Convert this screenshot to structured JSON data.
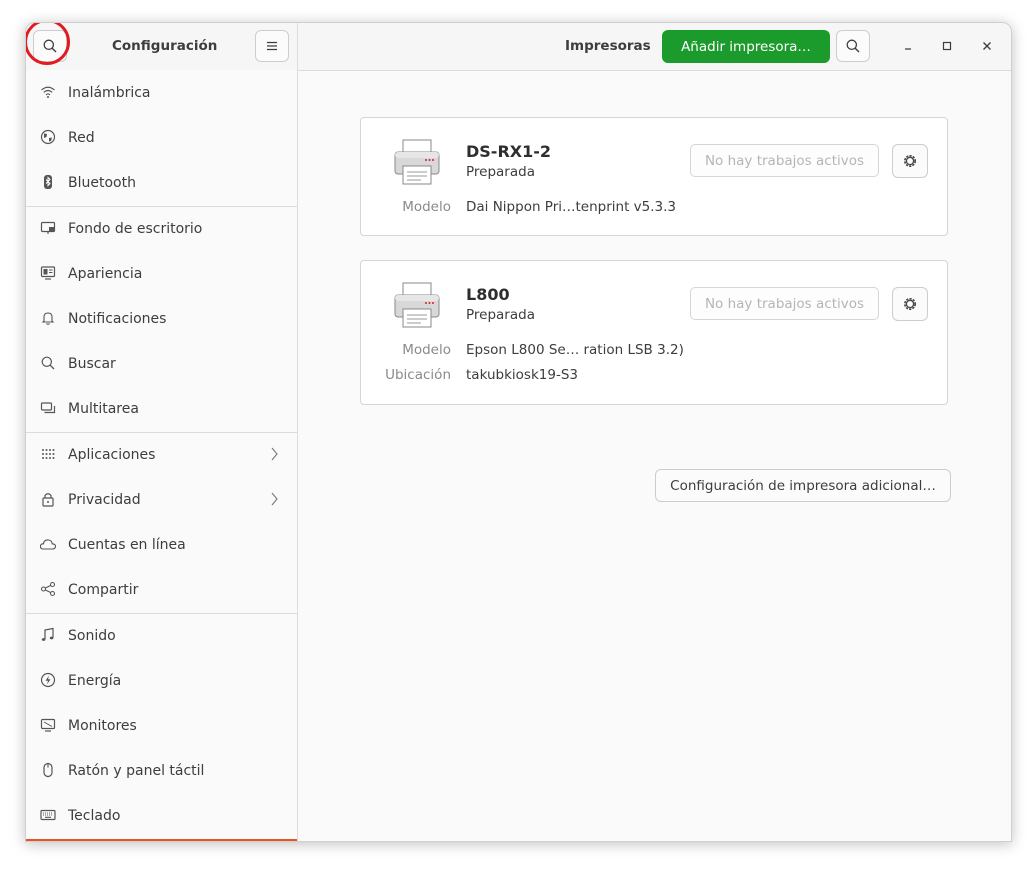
{
  "header": {
    "sidebar_title": "Configuración",
    "page_title": "Impresoras",
    "add_printer_label": "Añadir impresora…",
    "minimize": "–",
    "maximize": "□",
    "close": "×"
  },
  "sidebar": {
    "items": [
      {
        "label": "Inalámbrica",
        "icon": "wifi-icon"
      },
      {
        "label": "Red",
        "icon": "globe-icon"
      },
      {
        "label": "Bluetooth",
        "icon": "bluetooth-icon"
      },
      {
        "label": "Fondo de escritorio",
        "icon": "desktop-background-icon"
      },
      {
        "label": "Apariencia",
        "icon": "appearance-icon"
      },
      {
        "label": "Notificaciones",
        "icon": "bell-icon"
      },
      {
        "label": "Buscar",
        "icon": "search-icon"
      },
      {
        "label": "Multitarea",
        "icon": "multitasking-icon"
      },
      {
        "label": "Aplicaciones",
        "icon": "apps-grid-icon"
      },
      {
        "label": "Privacidad",
        "icon": "lock-icon"
      },
      {
        "label": "Cuentas en línea",
        "icon": "cloud-icon"
      },
      {
        "label": "Compartir",
        "icon": "share-icon"
      },
      {
        "label": "Sonido",
        "icon": "music-note-icon"
      },
      {
        "label": "Energía",
        "icon": "power-icon"
      },
      {
        "label": "Monitores",
        "icon": "monitor-icon"
      },
      {
        "label": "Ratón y panel táctil",
        "icon": "mouse-icon"
      },
      {
        "label": "Teclado",
        "icon": "keyboard-icon"
      }
    ]
  },
  "printers": [
    {
      "name": "DS-RX1-2",
      "state": "Preparada",
      "jobs_label": "No hay trabajos activos",
      "model_key": "Modelo",
      "model_value": "Dai Nippon Pri…tenprint v5.3.3"
    },
    {
      "name": "L800",
      "state": "Preparada",
      "jobs_label": "No hay trabajos activos",
      "model_key": "Modelo",
      "model_value": "Epson L800 Se… ration LSB 3.2)",
      "location_key": "Ubicación",
      "location_value": "takubkiosk19-S3"
    }
  ],
  "extra_settings_label": "Configuración de impresora adicional…",
  "colors": {
    "accent_green": "#1c9b2d",
    "sidebar_accent": "#e95420",
    "annotation_red": "#e01b24"
  }
}
